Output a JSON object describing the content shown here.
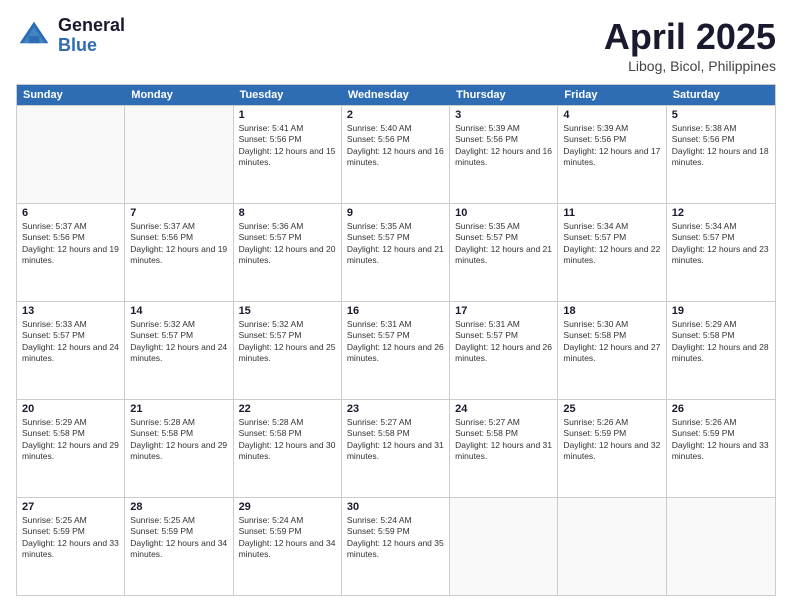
{
  "header": {
    "logo_general": "General",
    "logo_blue": "Blue",
    "title": "April 2025",
    "location": "Libog, Bicol, Philippines"
  },
  "weekdays": [
    "Sunday",
    "Monday",
    "Tuesday",
    "Wednesday",
    "Thursday",
    "Friday",
    "Saturday"
  ],
  "weeks": [
    [
      {
        "day": "",
        "sunrise": "",
        "sunset": "",
        "daylight": "",
        "empty": true
      },
      {
        "day": "",
        "sunrise": "",
        "sunset": "",
        "daylight": "",
        "empty": true
      },
      {
        "day": "1",
        "sunrise": "Sunrise: 5:41 AM",
        "sunset": "Sunset: 5:56 PM",
        "daylight": "Daylight: 12 hours and 15 minutes."
      },
      {
        "day": "2",
        "sunrise": "Sunrise: 5:40 AM",
        "sunset": "Sunset: 5:56 PM",
        "daylight": "Daylight: 12 hours and 16 minutes."
      },
      {
        "day": "3",
        "sunrise": "Sunrise: 5:39 AM",
        "sunset": "Sunset: 5:56 PM",
        "daylight": "Daylight: 12 hours and 16 minutes."
      },
      {
        "day": "4",
        "sunrise": "Sunrise: 5:39 AM",
        "sunset": "Sunset: 5:56 PM",
        "daylight": "Daylight: 12 hours and 17 minutes."
      },
      {
        "day": "5",
        "sunrise": "Sunrise: 5:38 AM",
        "sunset": "Sunset: 5:56 PM",
        "daylight": "Daylight: 12 hours and 18 minutes."
      }
    ],
    [
      {
        "day": "6",
        "sunrise": "Sunrise: 5:37 AM",
        "sunset": "Sunset: 5:56 PM",
        "daylight": "Daylight: 12 hours and 19 minutes."
      },
      {
        "day": "7",
        "sunrise": "Sunrise: 5:37 AM",
        "sunset": "Sunset: 5:56 PM",
        "daylight": "Daylight: 12 hours and 19 minutes."
      },
      {
        "day": "8",
        "sunrise": "Sunrise: 5:36 AM",
        "sunset": "Sunset: 5:57 PM",
        "daylight": "Daylight: 12 hours and 20 minutes."
      },
      {
        "day": "9",
        "sunrise": "Sunrise: 5:35 AM",
        "sunset": "Sunset: 5:57 PM",
        "daylight": "Daylight: 12 hours and 21 minutes."
      },
      {
        "day": "10",
        "sunrise": "Sunrise: 5:35 AM",
        "sunset": "Sunset: 5:57 PM",
        "daylight": "Daylight: 12 hours and 21 minutes."
      },
      {
        "day": "11",
        "sunrise": "Sunrise: 5:34 AM",
        "sunset": "Sunset: 5:57 PM",
        "daylight": "Daylight: 12 hours and 22 minutes."
      },
      {
        "day": "12",
        "sunrise": "Sunrise: 5:34 AM",
        "sunset": "Sunset: 5:57 PM",
        "daylight": "Daylight: 12 hours and 23 minutes."
      }
    ],
    [
      {
        "day": "13",
        "sunrise": "Sunrise: 5:33 AM",
        "sunset": "Sunset: 5:57 PM",
        "daylight": "Daylight: 12 hours and 24 minutes."
      },
      {
        "day": "14",
        "sunrise": "Sunrise: 5:32 AM",
        "sunset": "Sunset: 5:57 PM",
        "daylight": "Daylight: 12 hours and 24 minutes."
      },
      {
        "day": "15",
        "sunrise": "Sunrise: 5:32 AM",
        "sunset": "Sunset: 5:57 PM",
        "daylight": "Daylight: 12 hours and 25 minutes."
      },
      {
        "day": "16",
        "sunrise": "Sunrise: 5:31 AM",
        "sunset": "Sunset: 5:57 PM",
        "daylight": "Daylight: 12 hours and 26 minutes."
      },
      {
        "day": "17",
        "sunrise": "Sunrise: 5:31 AM",
        "sunset": "Sunset: 5:57 PM",
        "daylight": "Daylight: 12 hours and 26 minutes."
      },
      {
        "day": "18",
        "sunrise": "Sunrise: 5:30 AM",
        "sunset": "Sunset: 5:58 PM",
        "daylight": "Daylight: 12 hours and 27 minutes."
      },
      {
        "day": "19",
        "sunrise": "Sunrise: 5:29 AM",
        "sunset": "Sunset: 5:58 PM",
        "daylight": "Daylight: 12 hours and 28 minutes."
      }
    ],
    [
      {
        "day": "20",
        "sunrise": "Sunrise: 5:29 AM",
        "sunset": "Sunset: 5:58 PM",
        "daylight": "Daylight: 12 hours and 29 minutes."
      },
      {
        "day": "21",
        "sunrise": "Sunrise: 5:28 AM",
        "sunset": "Sunset: 5:58 PM",
        "daylight": "Daylight: 12 hours and 29 minutes."
      },
      {
        "day": "22",
        "sunrise": "Sunrise: 5:28 AM",
        "sunset": "Sunset: 5:58 PM",
        "daylight": "Daylight: 12 hours and 30 minutes."
      },
      {
        "day": "23",
        "sunrise": "Sunrise: 5:27 AM",
        "sunset": "Sunset: 5:58 PM",
        "daylight": "Daylight: 12 hours and 31 minutes."
      },
      {
        "day": "24",
        "sunrise": "Sunrise: 5:27 AM",
        "sunset": "Sunset: 5:58 PM",
        "daylight": "Daylight: 12 hours and 31 minutes."
      },
      {
        "day": "25",
        "sunrise": "Sunrise: 5:26 AM",
        "sunset": "Sunset: 5:59 PM",
        "daylight": "Daylight: 12 hours and 32 minutes."
      },
      {
        "day": "26",
        "sunrise": "Sunrise: 5:26 AM",
        "sunset": "Sunset: 5:59 PM",
        "daylight": "Daylight: 12 hours and 33 minutes."
      }
    ],
    [
      {
        "day": "27",
        "sunrise": "Sunrise: 5:25 AM",
        "sunset": "Sunset: 5:59 PM",
        "daylight": "Daylight: 12 hours and 33 minutes."
      },
      {
        "day": "28",
        "sunrise": "Sunrise: 5:25 AM",
        "sunset": "Sunset: 5:59 PM",
        "daylight": "Daylight: 12 hours and 34 minutes."
      },
      {
        "day": "29",
        "sunrise": "Sunrise: 5:24 AM",
        "sunset": "Sunset: 5:59 PM",
        "daylight": "Daylight: 12 hours and 34 minutes."
      },
      {
        "day": "30",
        "sunrise": "Sunrise: 5:24 AM",
        "sunset": "Sunset: 5:59 PM",
        "daylight": "Daylight: 12 hours and 35 minutes."
      },
      {
        "day": "",
        "sunrise": "",
        "sunset": "",
        "daylight": "",
        "empty": true
      },
      {
        "day": "",
        "sunrise": "",
        "sunset": "",
        "daylight": "",
        "empty": true
      },
      {
        "day": "",
        "sunrise": "",
        "sunset": "",
        "daylight": "",
        "empty": true
      }
    ]
  ]
}
